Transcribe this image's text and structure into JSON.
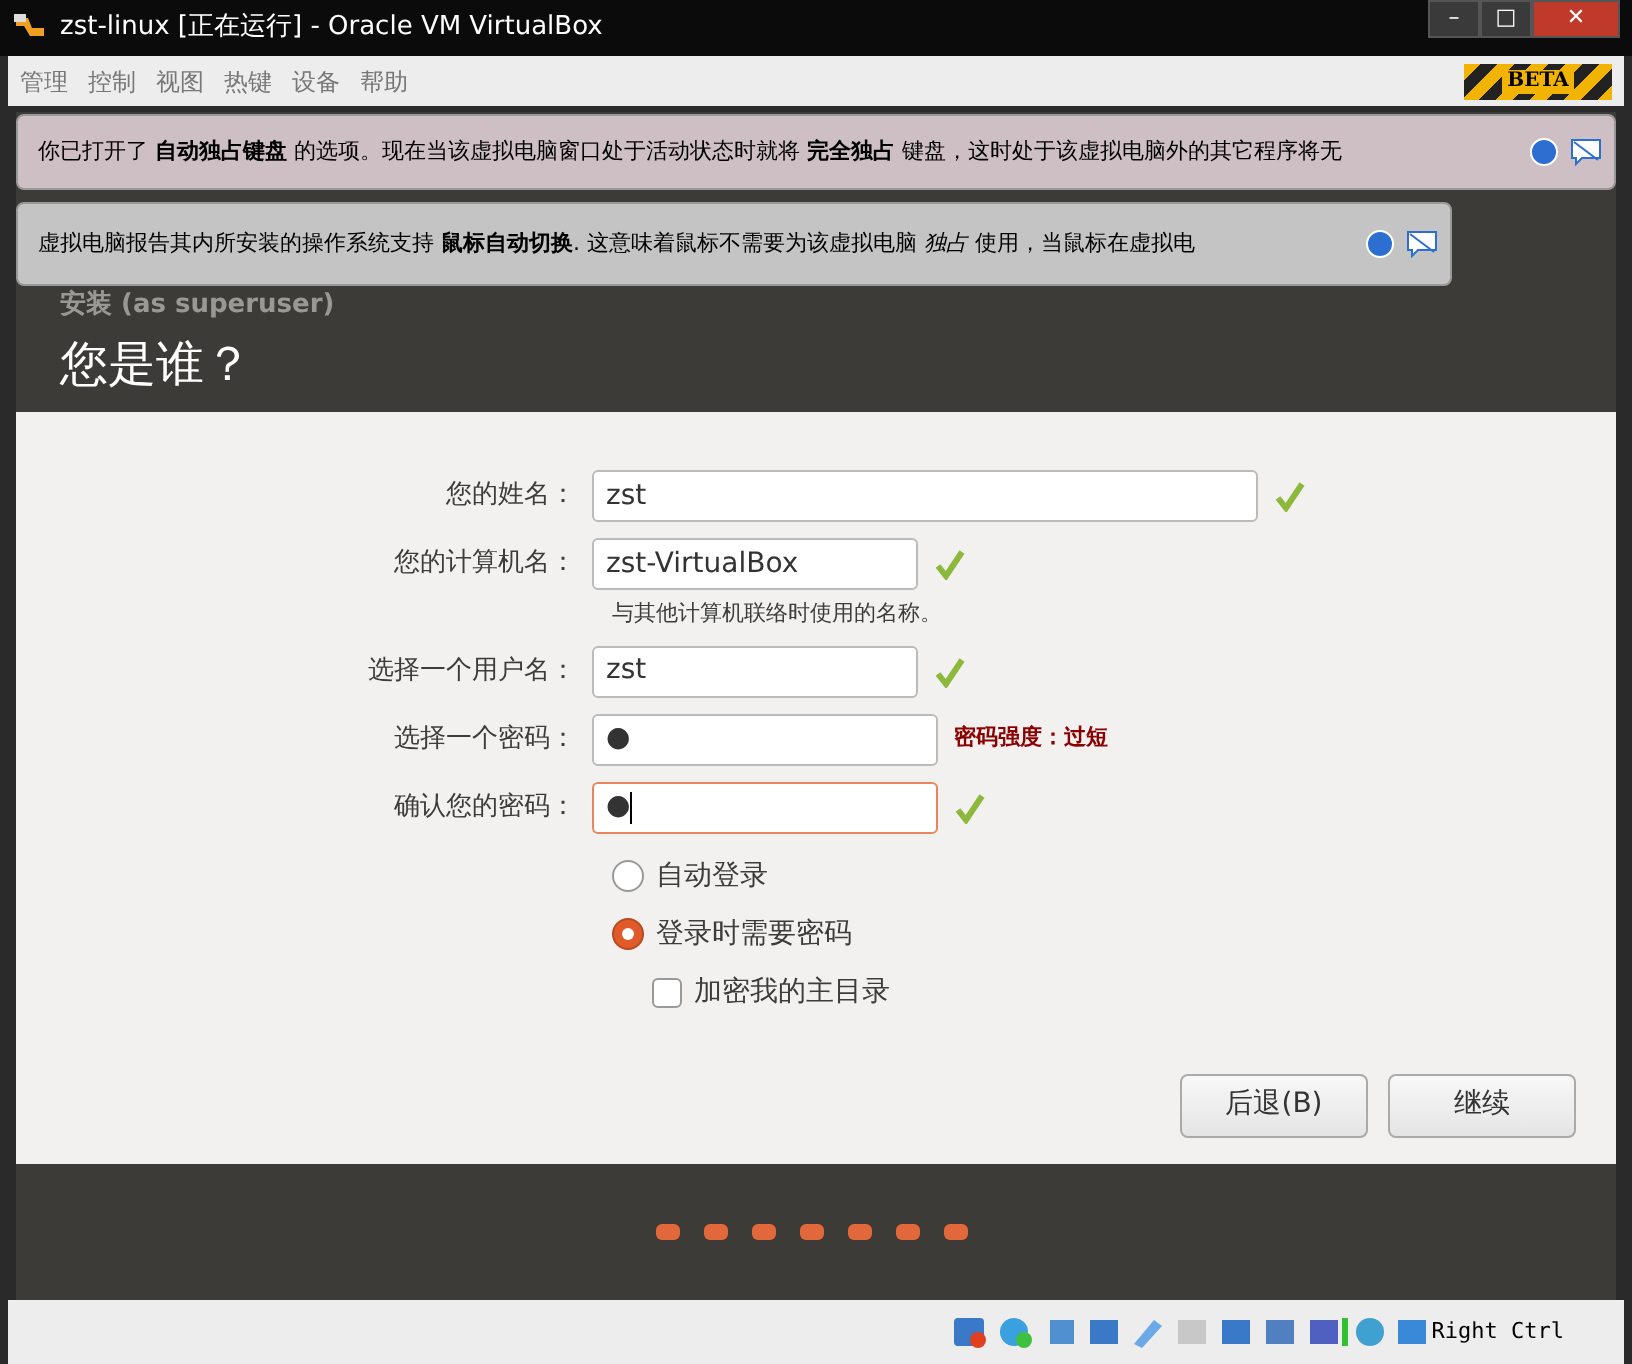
{
  "window": {
    "title": "zst-linux [正在运行] - Oracle VM VirtualBox",
    "controls": [
      "–",
      "□",
      "✕"
    ]
  },
  "menu": [
    "管理",
    "控制",
    "视图",
    "热键",
    "设备",
    "帮助"
  ],
  "beta_badge": "BETA",
  "notifications": [
    {
      "kind": "keyboard",
      "text": "你已打开了 **自动独占键盘** 的选项。现在当该虚拟电脑窗口处于活动状态时就将 **完全独占** 键盘，这时处于该虚拟电脑外的其它程序将无"
    },
    {
      "kind": "mouse",
      "text": "虚拟电脑报告其内所安装的操作系统支持 **鼠标自动切换**. 这意味着鼠标不需要为该虚拟电脑 *独占* 使用，当鼠标在虚拟电"
    }
  ],
  "installer": {
    "window_title": "安装 (as superuser)",
    "heading": "您是谁？",
    "fields": [
      {
        "label": "您的姓名：",
        "value": "zst",
        "valid": true,
        "focused": false,
        "wide": true
      },
      {
        "label": "您的计算机名：",
        "value": "zst-VirtualBox",
        "valid": true,
        "focused": false,
        "hint": "与其他计算机联络时使用的名称。"
      },
      {
        "label": "选择一个用户名：",
        "value": "zst",
        "valid": true,
        "focused": false
      },
      {
        "label": "选择一个密码：",
        "value": "●",
        "valid": false,
        "focused": false,
        "strength": "密码强度：过短"
      },
      {
        "label": "确认您的密码：",
        "value": "●",
        "valid": true,
        "focused": true
      }
    ],
    "login_options": [
      {
        "label": "自动登录",
        "selected": false
      },
      {
        "label": "登录时需要密码",
        "selected": true
      }
    ],
    "encrypt_home": {
      "label": "加密我的主目录",
      "checked": false
    },
    "buttons": [
      "后退(B)",
      "继续"
    ]
  },
  "status_bar": {
    "host_key": "Right Ctrl"
  }
}
